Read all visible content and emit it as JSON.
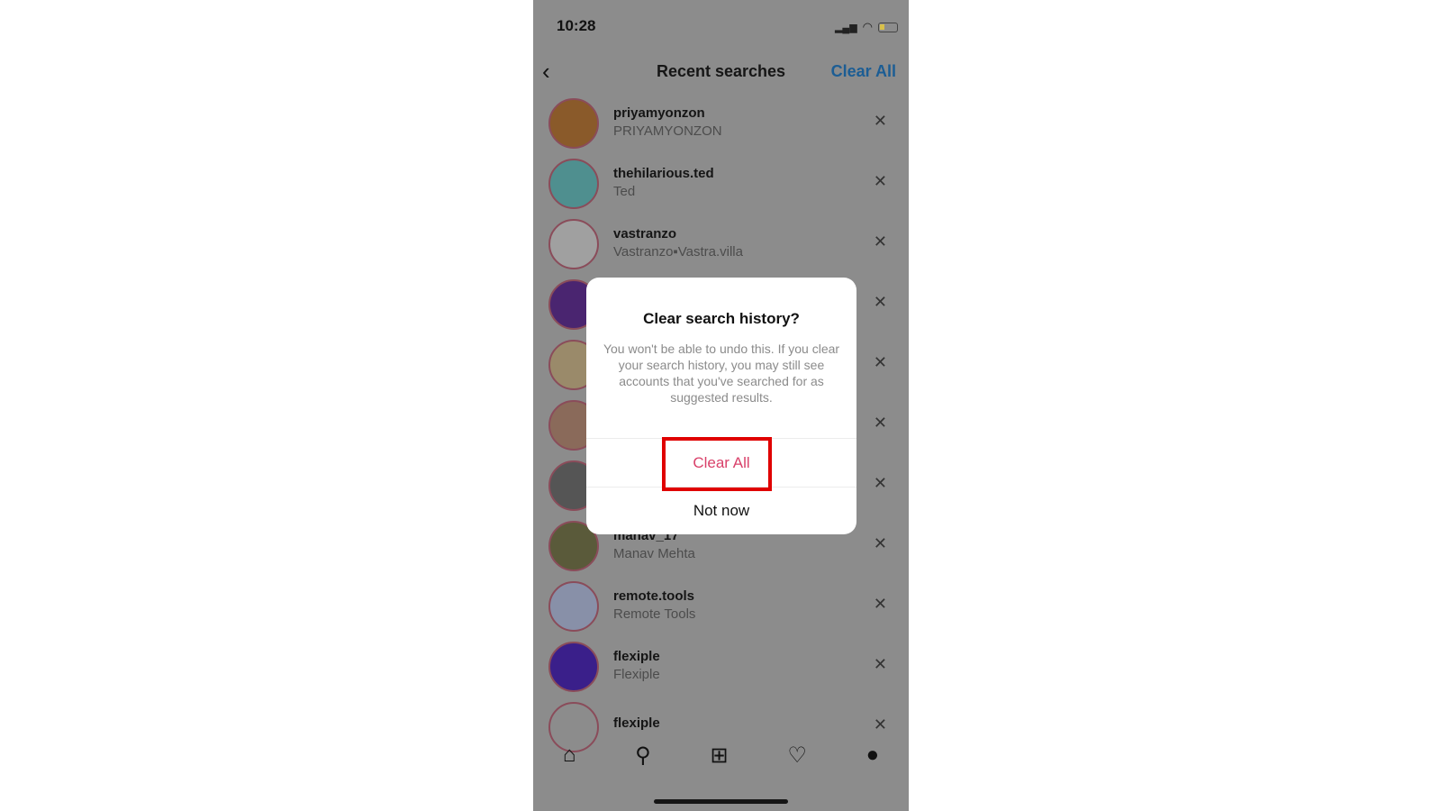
{
  "status": {
    "time": "10:28"
  },
  "header": {
    "title": "Recent searches",
    "clear_all": "Clear All"
  },
  "rows": [
    {
      "username": "priyamyonzon",
      "name": "PRIYAMYONZON",
      "color": "#8a5a2a"
    },
    {
      "username": "thehilarious.ted",
      "name": "Ted",
      "color": "#4f8f8f"
    },
    {
      "username": "vastranzo",
      "name": "Vastranzo▪Vastra.villa",
      "color": "#a0a0a0"
    },
    {
      "username": "",
      "name": "",
      "color": "#4a2570"
    },
    {
      "username": "",
      "name": "",
      "color": "#9a8a6a"
    },
    {
      "username": "",
      "name": "",
      "color": "#8a6a5a"
    },
    {
      "username": "",
      "name": "",
      "color": "#555555"
    },
    {
      "username": "manav_17",
      "name": "Manav Mehta",
      "color": "#5a5a3a"
    },
    {
      "username": "remote.tools",
      "name": "Remote Tools",
      "color": "#8890a8"
    },
    {
      "username": "flexiple",
      "name": "Flexiple",
      "color": "#3a1f8a"
    },
    {
      "username": "flexiple",
      "name": "",
      "color": "#8c8c8c"
    }
  ],
  "dialog": {
    "title": "Clear search history?",
    "body": "You won't be able to undo this. If you clear your search history, you may still see accounts that you've searched for as suggested results.",
    "clear_all": "Clear All",
    "not_now": "Not now"
  },
  "annotation": {
    "highlight_color": "#e00000"
  }
}
